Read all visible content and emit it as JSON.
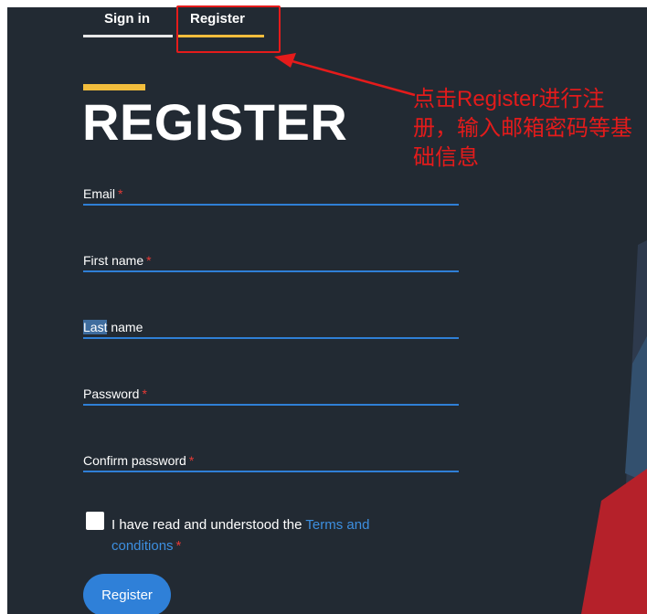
{
  "tabs": [
    {
      "label": "Sign in",
      "active": false
    },
    {
      "label": "Register",
      "active": true
    }
  ],
  "page_title": "REGISTER",
  "fields": {
    "email": {
      "label": "Email",
      "required": "*"
    },
    "first_name": {
      "label": "First name",
      "required": "*"
    },
    "last_name": {
      "label_selected": "Last",
      "label_rest": " name"
    },
    "password": {
      "label": "Password",
      "required": "*"
    },
    "confirm_password": {
      "label": "Confirm password",
      "required": "*"
    }
  },
  "terms": {
    "text": "I have read and understood the ",
    "link": "Terms and conditions",
    "required": "*",
    "checked": false
  },
  "register_button": "Register",
  "annotation": {
    "text": "点击Register进行注册，输入邮箱密码等基础信息"
  },
  "colors": {
    "panel_bg": "#222a33",
    "accent": "#f2bd3c",
    "field_underline": "#2f7fd6",
    "link": "#3d8fe0",
    "required": "#e53935",
    "annotation": "#e31b1b"
  }
}
